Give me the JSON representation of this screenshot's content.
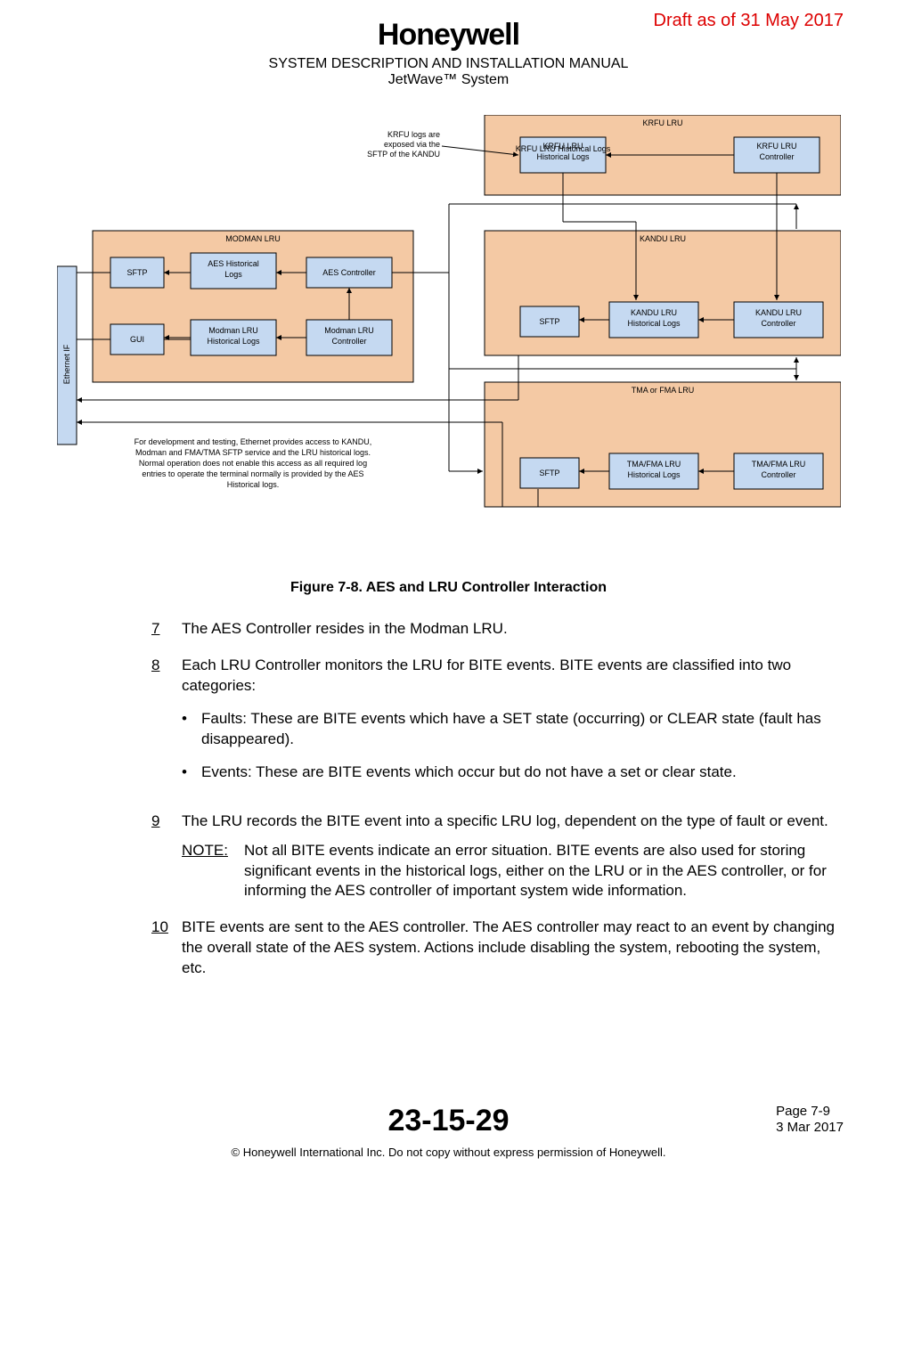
{
  "header": {
    "draft": "Draft as of 31 May 2017",
    "logo": "Honeywell",
    "title1": "SYSTEM DESCRIPTION AND INSTALLATION MANUAL",
    "title2": "JetWave™ System"
  },
  "figure_caption": "Figure 7-8.  AES and LRU Controller Interaction",
  "diagram": {
    "krfu_title": "KRFU LRU",
    "krfu_logs": "KRFU LRU Historical Logs",
    "krfu_ctrl": "KRFU LRU Controller",
    "krfu_note1": "KRFU logs are",
    "krfu_note2": "exposed via the",
    "krfu_note3": "SFTP of the KANDU",
    "modman_title": "MODMAN LRU",
    "sftp": "SFTP",
    "aes_hist": "AES Historical Logs",
    "aes_ctrl": "AES Controller",
    "gui": "GUI",
    "modman_logs": "Modman LRU Historical Logs",
    "modman_ctrl": "Modman LRU Controller",
    "ethernet": "Ethernet IF",
    "kandu_title": "KANDU LRU",
    "kandu_logs": "KANDU LRU Historical Logs",
    "kandu_ctrl": "KANDU LRU Controller",
    "tma_title": "TMA or FMA LRU",
    "tma_logs": "TMA/FMA LRU Historical Logs",
    "tma_ctrl": "TMA/FMA LRU Controller",
    "dev_note1": "For development and testing, Ethernet provides access to KANDU,",
    "dev_note2": "Modman and FMA/TMA SFTP service and the LRU historical logs.",
    "dev_note3": "Normal operation does not enable this access as all required log",
    "dev_note4": "entries to operate the terminal normally is provided by the AES",
    "dev_note5": "Historical logs."
  },
  "text": {
    "item7_num": "7",
    "item7": "The AES Controller resides in the Modman LRU.",
    "item8_num": "8",
    "item8": "Each LRU Controller monitors the LRU for BITE events. BITE events are classified into two categories:",
    "bullet1": "Faults: These are BITE events which have a SET state (occurring) or CLEAR state (fault has disappeared).",
    "bullet2": " Events: These are BITE events which occur but do not have a set or clear state.",
    "item9_num": "9",
    "item9": "The LRU records the BITE event into a specific LRU log, dependent on the type of fault or event.",
    "note_lbl": "NOTE:",
    "note": "Not all BITE events indicate an error situation. BITE events are also used for storing significant events in the historical logs, either on the LRU or in the AES controller, or for informing the AES controller of important system wide information.",
    "item10_num": "10",
    "item10": "BITE events are sent to the AES controller. The AES controller may react to an event by changing the overall state of the AES system. Actions include disabling the system, rebooting the system, etc."
  },
  "footer": {
    "page": "Page 7-9",
    "date": "3 Mar 2017",
    "docnum": "23-15-29",
    "copyright": "© Honeywell International Inc. Do not copy without express permission of Honeywell."
  }
}
